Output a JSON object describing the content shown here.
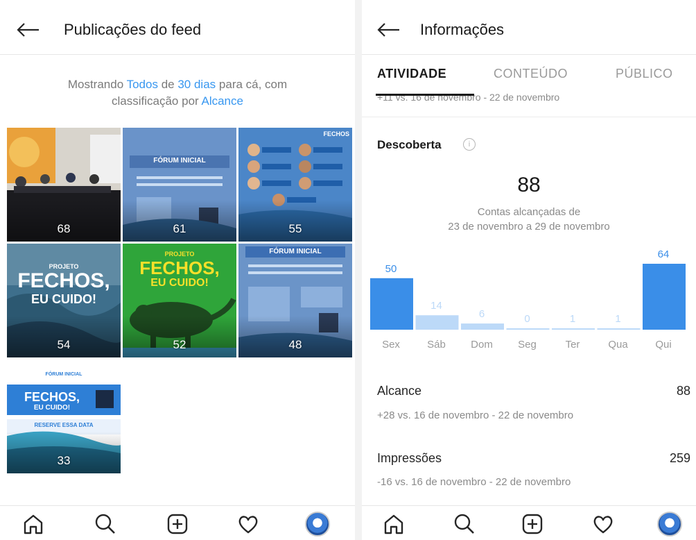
{
  "colors": {
    "accent": "#3897f0",
    "bar_dark": "#3a8ee8",
    "bar_light": "#bcd9f8",
    "text": "#262626",
    "muted": "#8a8a8a"
  },
  "feed": {
    "title": "Publicações do feed",
    "info": {
      "prefix": "Mostrando",
      "filter": "Todos",
      "mid": "de",
      "period": "30 dias",
      "suffix": "para cá, com",
      "line2_prefix": "classificação por",
      "sort": "Alcance"
    },
    "posts": [
      {
        "count": "68",
        "caption": "",
        "theme": "photo"
      },
      {
        "count": "61",
        "caption": "FÓRUM INICIAL",
        "theme": "blue"
      },
      {
        "count": "55",
        "caption": "FECHOS",
        "theme": "blue2"
      },
      {
        "count": "54",
        "caption": "PROJETO FECHOS, EU CUIDO!",
        "theme": "water"
      },
      {
        "count": "52",
        "caption": "PROJETO FECHOS, EU CUIDO!",
        "theme": "green"
      },
      {
        "count": "48",
        "caption": "FÓRUM INICIAL",
        "theme": "blue"
      },
      {
        "count": "33",
        "caption": "FECHOS, EU CUIDO!",
        "theme": "white"
      }
    ],
    "post_texts": {
      "forum": "FÓRUM INICIAL",
      "projeto": "PROJETO",
      "fechos": "FECHOS,",
      "eu_cuido": "EU CUIDO!",
      "reserve": "RESERVE ESSA DATA",
      "fechos_small": "FECHOS"
    }
  },
  "insights": {
    "title": "Informações",
    "tabs": [
      "ATIVIDADE",
      "CONTEÚDO",
      "PÚBLICO"
    ],
    "cut_off_text": "+11 vs. 16 de novembro - 22 de novembro",
    "discovery": {
      "title": "Descoberta",
      "info_icon": "i",
      "reach_total": "88",
      "reach_label": "Contas alcançadas de",
      "reach_period": "23 de novembro a 29 de novembro"
    },
    "metrics": [
      {
        "label": "Alcance",
        "value": "88",
        "sub": "+28 vs. 16 de novembro - 22 de novembro"
      },
      {
        "label": "Impressões",
        "value": "259",
        "sub": "-16 vs. 16 de novembro - 22 de novembro"
      }
    ]
  },
  "chart_data": {
    "type": "bar",
    "categories": [
      "Sex",
      "Sáb",
      "Dom",
      "Seg",
      "Ter",
      "Qua",
      "Qui"
    ],
    "values": [
      50,
      14,
      6,
      0,
      1,
      1,
      64
    ],
    "highlight": [
      true,
      false,
      false,
      false,
      false,
      false,
      true
    ],
    "title": "",
    "xlabel": "",
    "ylabel": "",
    "ylim": [
      0,
      64
    ]
  },
  "nav": {
    "icons": [
      "home-icon",
      "search-icon",
      "add-icon",
      "heart-icon",
      "profile-avatar"
    ]
  }
}
